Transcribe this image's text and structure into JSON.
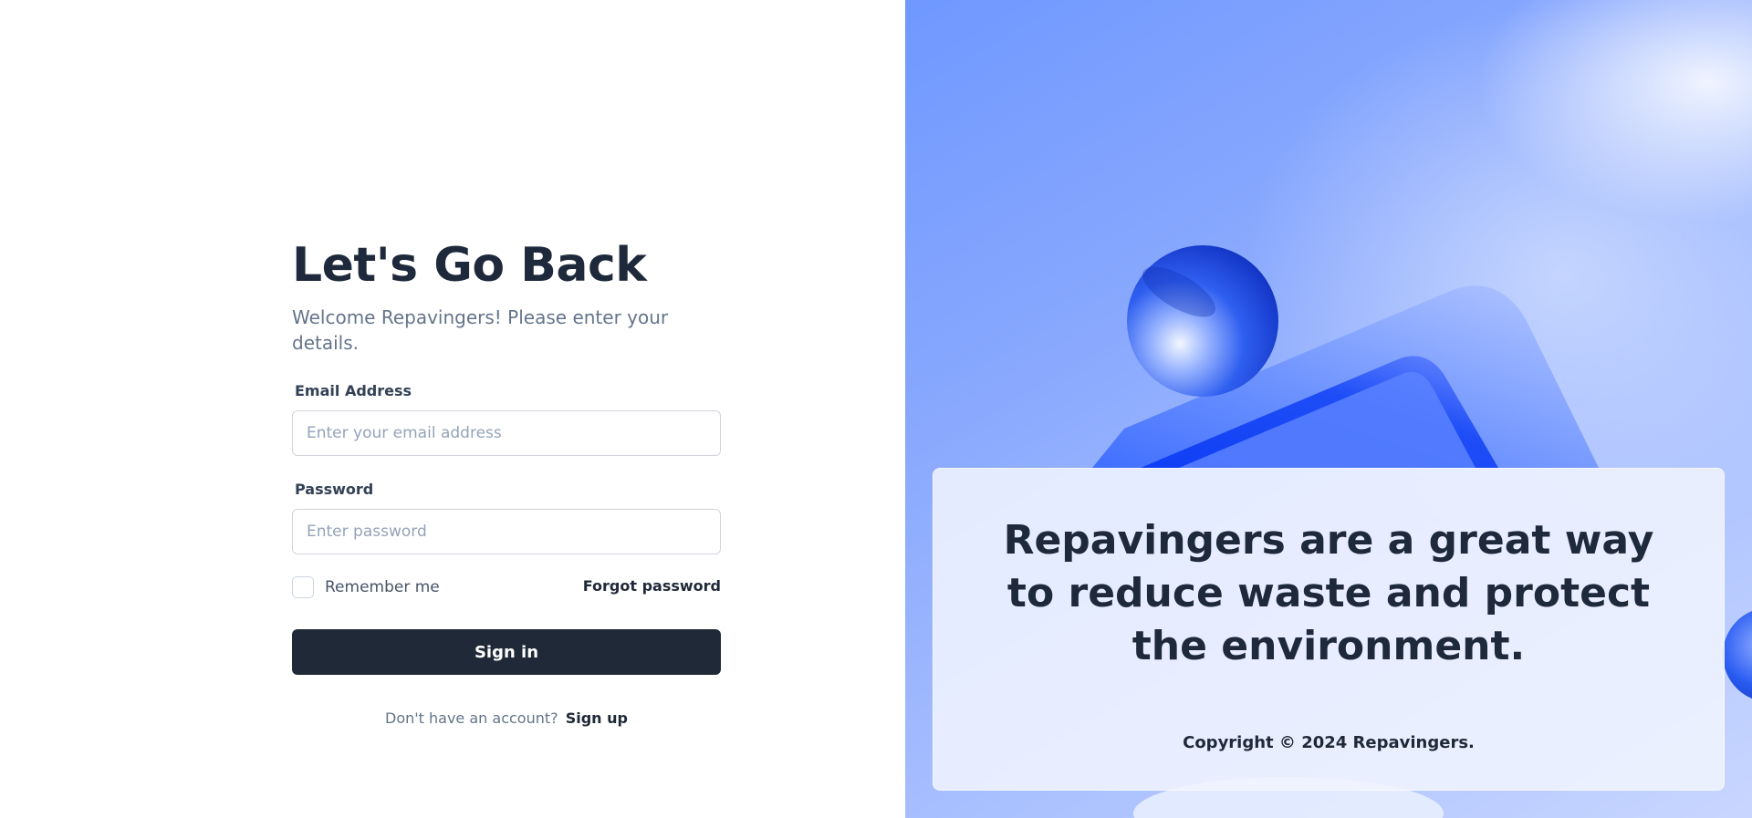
{
  "login": {
    "title": "Let's Go Back",
    "subtitle": "Welcome Repavingers! Please enter your details.",
    "email_label": "Email Address",
    "email_placeholder": "Enter your email address",
    "password_label": "Password",
    "password_placeholder": "Enter password",
    "remember_label": "Remember me",
    "remember_checked": false,
    "forgot_label": "Forgot password",
    "signin_label": "Sign in",
    "signup_prompt": "Don't have an account?",
    "signup_label": "Sign up"
  },
  "hero": {
    "quote": "Repavingers are a great way to reduce waste and protect the environment.",
    "copyright": "Copyright © 2024 Repavingers."
  },
  "colors": {
    "primary": "#1f2937",
    "accent_blue": "#1d4ed8",
    "panel_blue": "#8aa9fe"
  }
}
